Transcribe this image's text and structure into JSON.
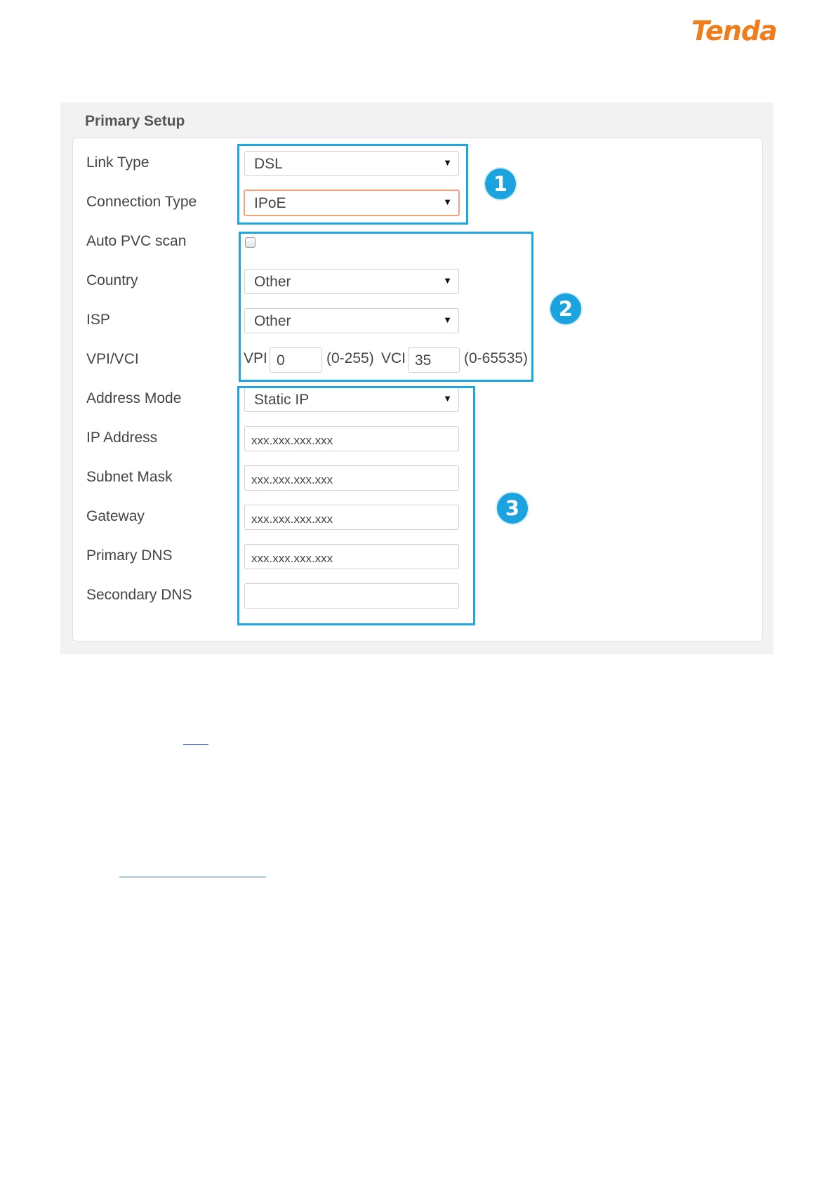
{
  "brand": {
    "logo_text": "Tenda",
    "color": "#f07d1a"
  },
  "section": {
    "title": "Primary Setup"
  },
  "accent_color": "#1ea6df",
  "form": {
    "link_type": {
      "label": "Link Type",
      "value": "DSL"
    },
    "connection_type": {
      "label": "Connection Type",
      "value": "IPoE"
    },
    "auto_pvc_scan": {
      "label": "Auto PVC scan",
      "checked": false
    },
    "country": {
      "label": "Country",
      "value": "Other"
    },
    "isp": {
      "label": "ISP",
      "value": "Other"
    },
    "vpi_vci": {
      "label": "VPI/VCI",
      "vpi_label": "VPI",
      "vpi_value": "0",
      "vpi_range": "(0-255)",
      "vci_label": "VCI",
      "vci_value": "35",
      "vci_range": "(0-65535)"
    },
    "address_mode": {
      "label": "Address Mode",
      "value": "Static IP"
    },
    "ip_address": {
      "label": "IP Address",
      "value": "xxx.xxx.xxx.xxx"
    },
    "subnet_mask": {
      "label": "Subnet Mask",
      "value": "xxx.xxx.xxx.xxx"
    },
    "gateway": {
      "label": "Gateway",
      "value": "xxx.xxx.xxx.xxx"
    },
    "primary_dns": {
      "label": "Primary DNS",
      "value": "xxx.xxx.xxx.xxx"
    },
    "secondary_dns": {
      "label": "Secondary DNS",
      "value": ""
    }
  },
  "callouts": [
    "1",
    "2",
    "3"
  ],
  "icons": {
    "dropdown": "chevron-down-icon"
  }
}
